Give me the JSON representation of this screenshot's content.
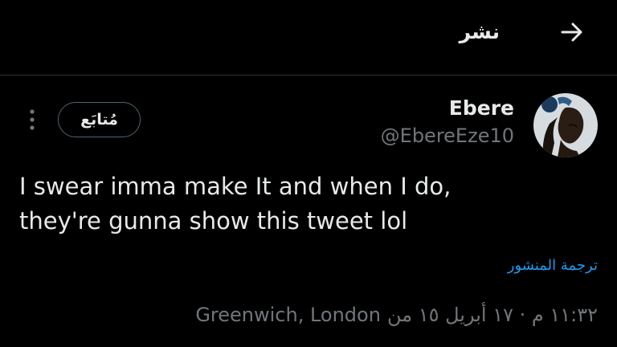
{
  "header": {
    "title": "نشر",
    "back_icon": "arrow-right-icon"
  },
  "author": {
    "display_name": "Ebere",
    "handle": "@EbereEze10",
    "avatar_icon": "avatar"
  },
  "actions": {
    "follow_label": "مُتابَع",
    "more_icon": "more-vertical-icon"
  },
  "tweet": {
    "text_line_1": "I swear imma make It and when I do,",
    "text_line_2": "they're gunna show this tweet lol",
    "translate_label": "ترجمة المنشور"
  },
  "meta": {
    "timestamp": "١١:٣٢ م · ١٧ أبريل ١٥ من",
    "location": "Greenwich, London"
  },
  "colors": {
    "background": "#000000",
    "text_primary": "#e7e9ea",
    "text_secondary": "#71767b",
    "accent": "#1d9bf0",
    "border": "#2f3336"
  }
}
